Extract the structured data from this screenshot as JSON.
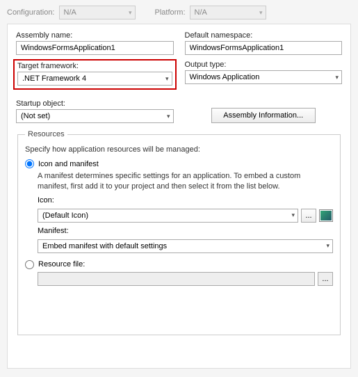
{
  "topbar": {
    "config_label": "Configuration:",
    "config_value": "N/A",
    "platform_label": "Platform:",
    "platform_value": "N/A"
  },
  "assembly": {
    "name_label": "Assembly name:",
    "name_value": "WindowsFormsApplication1",
    "namespace_label": "Default namespace:",
    "namespace_value": "WindowsFormsApplication1",
    "target_framework_label": "Target framework:",
    "target_framework_value": ".NET Framework 4",
    "output_type_label": "Output type:",
    "output_type_value": "Windows Application",
    "startup_label": "Startup object:",
    "startup_value": "(Not set)",
    "assembly_info_btn": "Assembly Information..."
  },
  "resources": {
    "legend": "Resources",
    "desc": "Specify how application resources will be managed:",
    "icon_manifest_label": "Icon and manifest",
    "manifest_help": "A manifest determines specific settings for an application. To embed a custom manifest, first add it to your project and then select it from the list below.",
    "icon_label": "Icon:",
    "icon_value": "(Default Icon)",
    "browse_btn": "...",
    "manifest_label": "Manifest:",
    "manifest_value": "Embed manifest with default settings",
    "resource_file_label": "Resource file:",
    "resource_file_value": "",
    "resource_browse_btn": "..."
  }
}
